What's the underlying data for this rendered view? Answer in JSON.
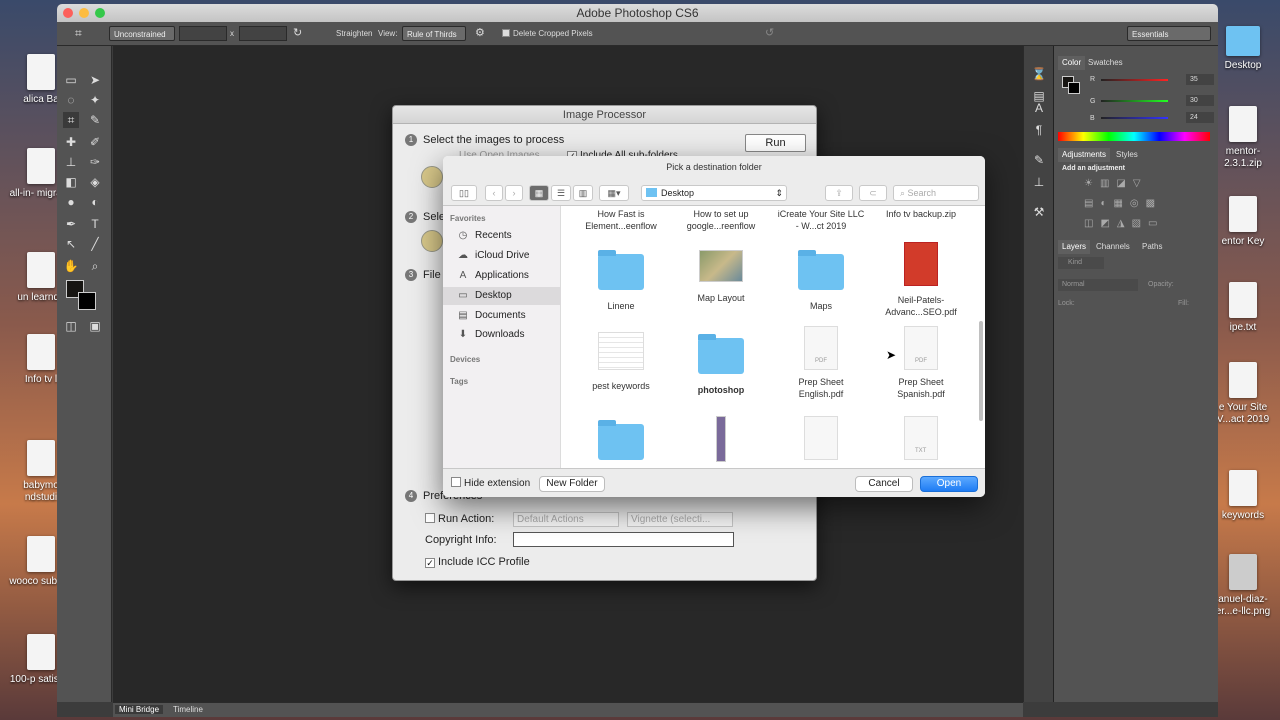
{
  "app": {
    "title": "Adobe Photoshop CS6"
  },
  "options_bar": {
    "ratio": "Unconstrained",
    "x_sep": "x",
    "straighten": "Straighten",
    "view_label": "View:",
    "view_value": "Rule of Thirds",
    "delete_cropped": "Delete Cropped Pixels",
    "workspace": "Essentials"
  },
  "panels": {
    "color_tabs": [
      "Color",
      "Swatches"
    ],
    "rgb": [
      {
        "label": "R",
        "value": "35"
      },
      {
        "label": "G",
        "value": "30"
      },
      {
        "label": "B",
        "value": "24"
      }
    ],
    "adj_tabs": [
      "Adjustments",
      "Styles"
    ],
    "add_adjustment": "Add an adjustment",
    "layer_tabs": [
      "Layers",
      "Channels",
      "Paths"
    ],
    "kind": "Kind",
    "blend": "Normal",
    "opacity": "Opacity:",
    "lock": "Lock:",
    "fill": "Fill:"
  },
  "bottom_tabs": [
    "Mini Bridge",
    "Timeline"
  ],
  "desktop": {
    "left": [
      "alica Ba",
      "all-in- migratio",
      "un learnda",
      "Info tv l",
      "babymo ndstudi",
      "wooco subscri",
      "100-p satisfac"
    ],
    "right": [
      "Desktop",
      "mentor- 2.3.1.zip",
      "entor Key",
      "ipe.txt",
      "e Your Site V...act 2019",
      "keywords",
      "anuel-diaz- er...e-llc.png"
    ]
  },
  "image_processor": {
    "title": "Image Processor",
    "step1": "Select the images to process",
    "use_open": "Use Open Images",
    "include_sub": "Include All sub-folders",
    "step2": "Sele",
    "step3": "File",
    "run": "Run",
    "step4": "Preferences",
    "run_action": "Run Action:",
    "default_actions": "Default Actions",
    "vignette": "Vignette (selecti...",
    "copyright": "Copyright Info:",
    "icc": "Include ICC Profile"
  },
  "picker": {
    "title": "Pick a destination folder",
    "location": "Desktop",
    "search_placeholder": "Search",
    "favorites_header": "Favorites",
    "favorites": [
      {
        "label": "Recents",
        "icon": "clock-icon"
      },
      {
        "label": "iCloud Drive",
        "icon": "cloud-icon"
      },
      {
        "label": "Applications",
        "icon": "applications-icon"
      },
      {
        "label": "Desktop",
        "icon": "desktop-icon"
      },
      {
        "label": "Documents",
        "icon": "document-icon"
      },
      {
        "label": "Downloads",
        "icon": "download-icon"
      }
    ],
    "devices_header": "Devices",
    "tags_header": "Tags",
    "top_row": [
      "How Fast is Element...eenflow",
      "How to set up google...reenflow",
      "iCreate Your Site LLC - W...ct 2019",
      "Info tv backup.zip"
    ],
    "row2": [
      {
        "name": "Linene",
        "kind": "folder"
      },
      {
        "name": "Map Layout",
        "kind": "image"
      },
      {
        "name": "Maps",
        "kind": "folder"
      },
      {
        "name": "Neil-Patels- Advanc...SEO.pdf",
        "kind": "pdf-red"
      }
    ],
    "row3": [
      {
        "name": "pest keywords",
        "kind": "sheet"
      },
      {
        "name": "photoshop",
        "kind": "folder"
      },
      {
        "name": "Prep Sheet English.pdf",
        "kind": "pdf"
      },
      {
        "name": "Prep Sheet Spanish.pdf",
        "kind": "pdf"
      }
    ],
    "row4": [
      {
        "name": "",
        "kind": "folder"
      },
      {
        "name": "",
        "kind": "phone"
      },
      {
        "name": "",
        "kind": "blank"
      },
      {
        "name": "",
        "kind": "txt"
      }
    ],
    "pdf_tag": "PDF",
    "txt_tag": "TXT",
    "hide_extension": "Hide extension",
    "new_folder": "New Folder",
    "cancel": "Cancel",
    "open": "Open"
  },
  "colors": {
    "accent": "#1f7cf4",
    "folder": "#6ec2f2",
    "ps_panel": "#535353"
  }
}
